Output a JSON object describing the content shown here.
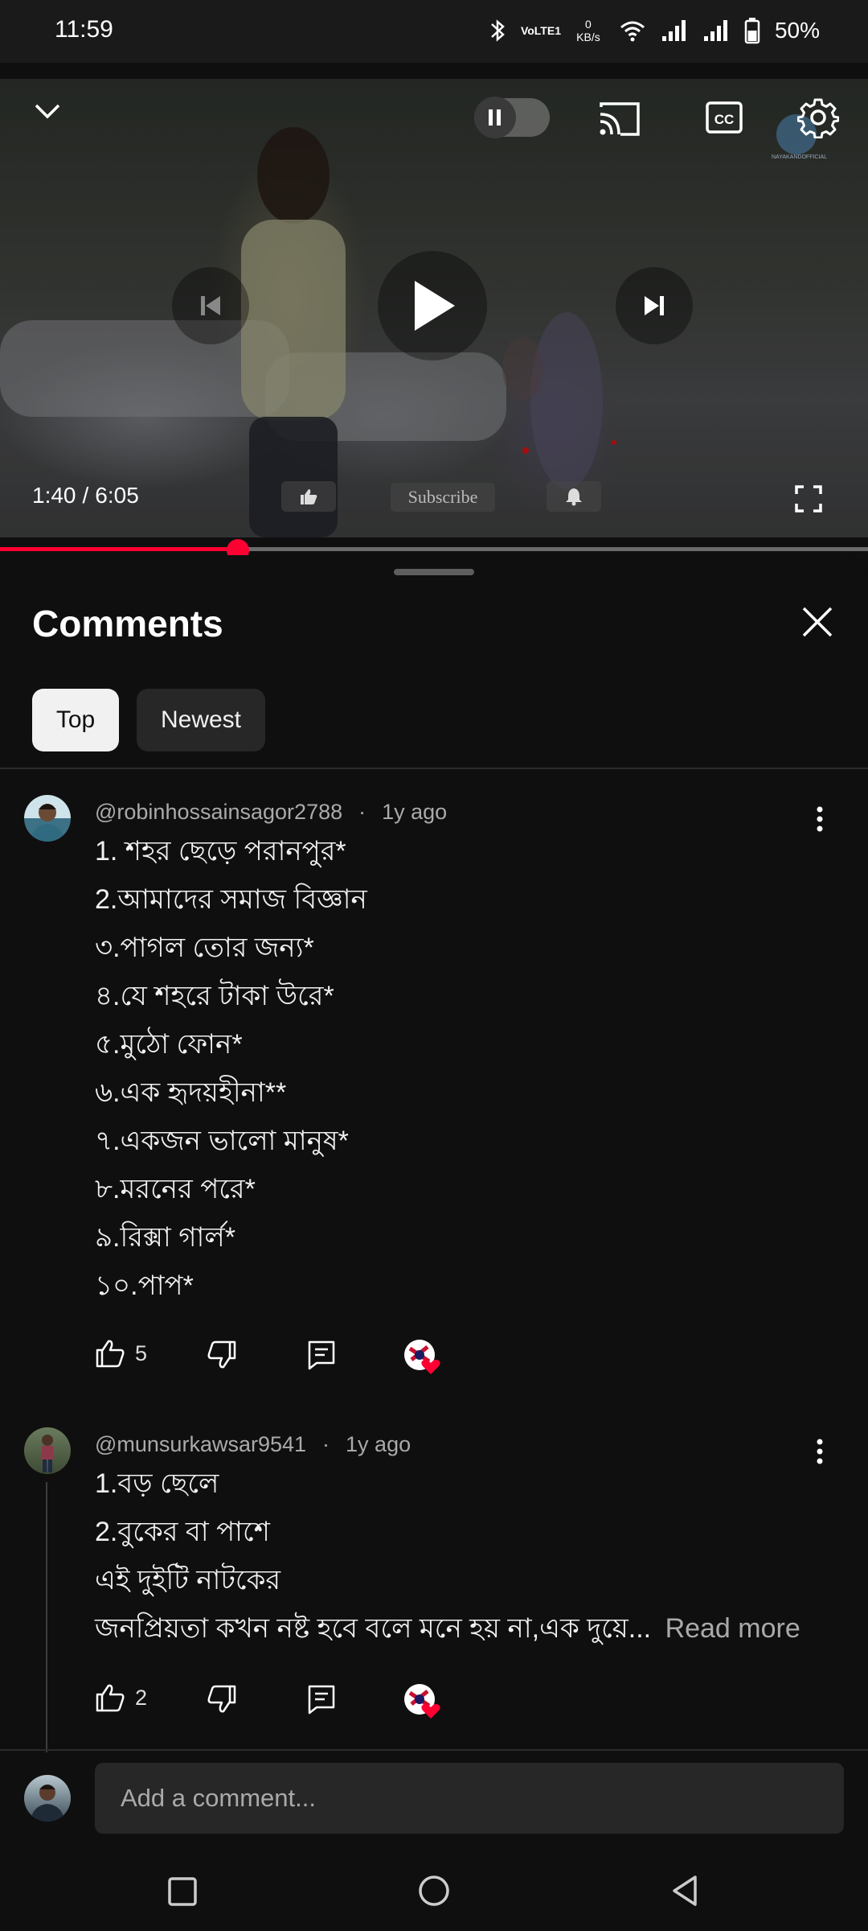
{
  "status_bar": {
    "time": "11:59",
    "net_speed_top": "0",
    "net_speed_bottom": "KB/s",
    "volte": "VoLTE1",
    "battery": "50%"
  },
  "player": {
    "time_current": "1:40",
    "time_separator": "/",
    "time_total": "6:05",
    "progress_fraction": 0.274,
    "overlay_subscribe": "Subscribe",
    "watermark": "NAYAKANDOFFICIAL"
  },
  "comments": {
    "title": "Comments",
    "filters": [
      "Top",
      "Newest"
    ],
    "selected_filter": "Top",
    "list": [
      {
        "author": "@robinhossainsagor2788",
        "age": "1y ago",
        "lines": [
          "1. শহর ছেড়ে পরানপুর*",
          "2.আমাদের সমাজ বিজ্ঞান",
          "৩.পাগল তোর জন্য*",
          "৪.যে শহরে টাকা উরে*",
          "৫.মুঠো ফোন*",
          "৬.এক হৃদয়হীনা**",
          "৭.একজন ভালো মানুষ*",
          "৮.মরনের পরে*",
          "৯.রিক্সা গার্ল*",
          "১০.পাপ*"
        ],
        "likes": "5"
      },
      {
        "author": "@munsurkawsar9541",
        "age": "1y ago",
        "lines": [
          "1.বড় ছেলে",
          "2.বুকের বা পাশে",
          "এই দুইটি নাটকের",
          "জনপ্রিয়তা কখন নষ্ট হবে বলে মনে হয় না,এক দুয়ে..."
        ],
        "read_more": "Read more",
        "likes": "2"
      }
    ],
    "add_placeholder": "Add a comment..."
  },
  "colors": {
    "accent": "#ff0033",
    "background": "#0f0f0f",
    "chip_selected": "#f1f1f1",
    "chip": "#272727"
  }
}
